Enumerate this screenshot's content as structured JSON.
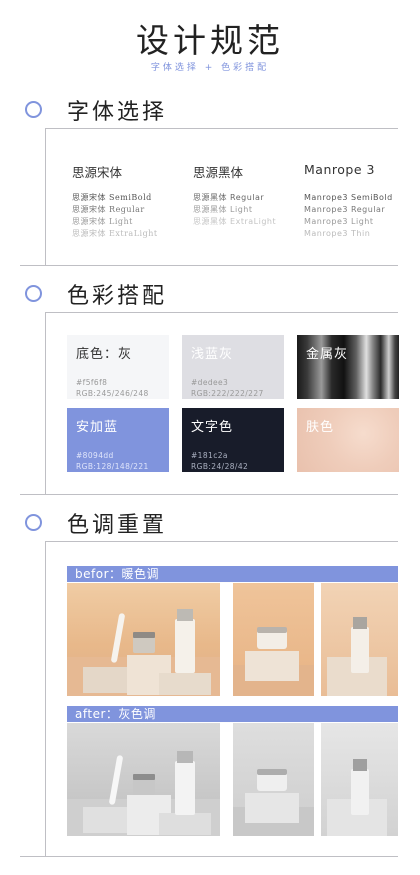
{
  "header": {
    "title": "设计规范",
    "subtitle": "字体选择 + 色彩搭配"
  },
  "sections": {
    "fonts": {
      "title": "字体选择"
    },
    "colors": {
      "title": "色彩搭配"
    },
    "tones": {
      "title": "色调重置"
    }
  },
  "fonts": [
    {
      "name": "思源宋体",
      "weights": [
        "思源宋体 SemiBold",
        "思源宋体 Regular",
        "思源宋体 Light",
        "思源宋体 ExtraLight"
      ]
    },
    {
      "name": "思源黑体",
      "weights": [
        "思源黑体 Regular",
        "思源黑体 Light",
        "思源黑体 ExtraLight"
      ]
    },
    {
      "name": "Manrope 3",
      "weights": [
        "Manrope3 SemiBold",
        "Manrope3 Regular",
        "Manrope3 Light",
        "Manrope3 Thin"
      ]
    }
  ],
  "swatches": [
    {
      "name": "底色：灰",
      "hex": "#f5f6f8",
      "rgb": "RGB:245/246/248",
      "color": "#f5f6f8"
    },
    {
      "name": "浅蓝灰",
      "hex": "#dedee3",
      "rgb": "RGB:222/222/227",
      "color": "#dedee3"
    },
    {
      "name": "金属灰"
    },
    {
      "name": "安加蓝",
      "hex": "#8094dd",
      "rgb": "RGB:128/148/221",
      "color": "#8094dd"
    },
    {
      "name": "文字色",
      "hex": "#181c2a",
      "rgb": "RGB:24/28/42",
      "color": "#181c2a"
    },
    {
      "name": "肤色",
      "color": "#f0d3c4"
    }
  ],
  "tones": {
    "before_label": "befor：暖色调",
    "after_label": "after：灰色调"
  }
}
